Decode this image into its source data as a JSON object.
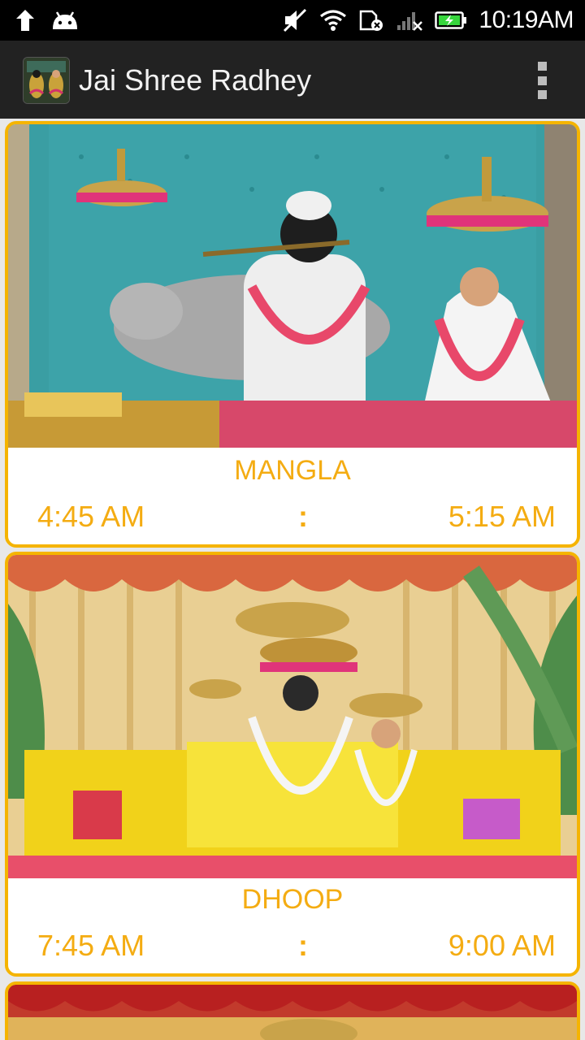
{
  "status_bar": {
    "time": "10:19AM",
    "icons": [
      "upload-arrow-icon",
      "android-icon",
      "mute-icon",
      "wifi-icon",
      "sim-error-icon",
      "signal-off-icon",
      "battery-charging-icon"
    ]
  },
  "app_bar": {
    "title": "Jai Shree Radhey",
    "icon": "app-logo-icon",
    "menu_icon": "overflow-menu-icon"
  },
  "colors": {
    "accent": "#f4ac12",
    "card_border": "#f5b400",
    "app_bar": "#222222",
    "status_bar": "#000000"
  },
  "darshans": [
    {
      "name": "MANGLA",
      "start": "4:45 AM",
      "separator": ":",
      "end": "5:15 AM"
    },
    {
      "name": "DHOOP",
      "start": "7:45 AM",
      "separator": ":",
      "end": "9:00 AM"
    }
  ]
}
